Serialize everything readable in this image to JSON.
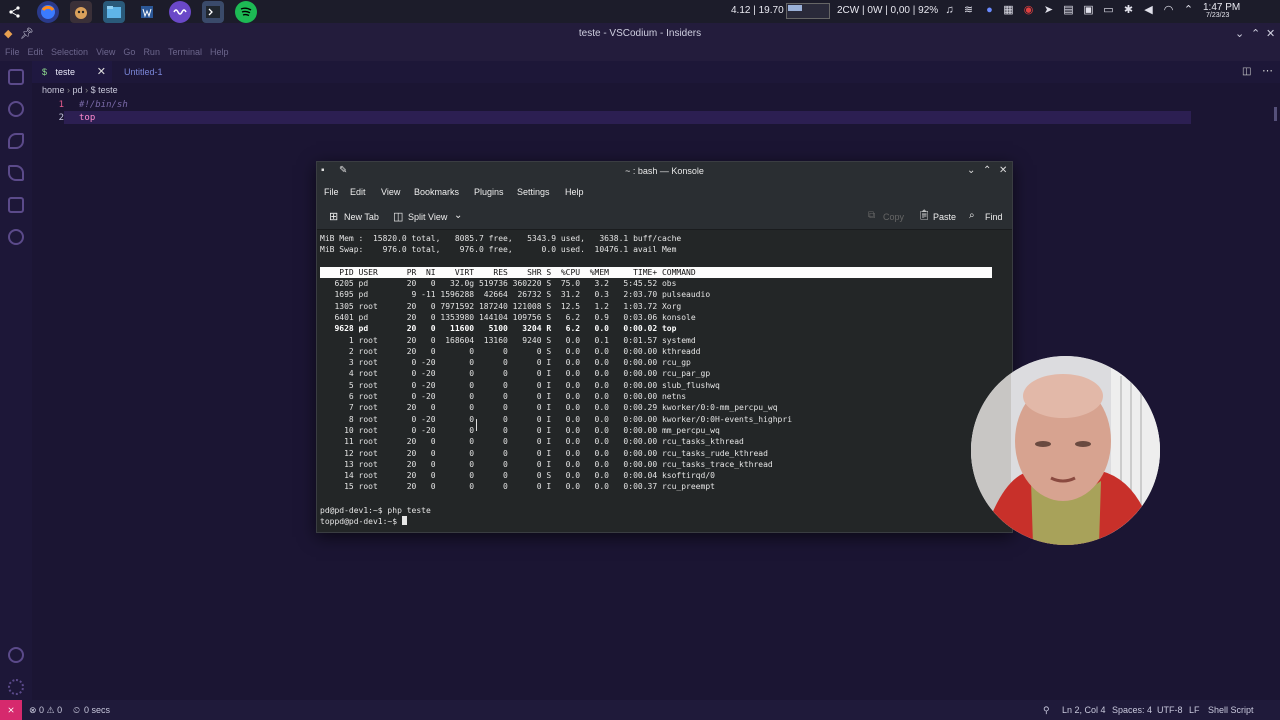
{
  "panel": {
    "tray": {
      "load": "4.12 | 19.70",
      "net": "2CW | 0W | 0,00 | 92%",
      "time": "1:47 PM",
      "date": "7/23/23"
    }
  },
  "vscodium": {
    "title": "teste - VSCodium - Insiders",
    "menu": [
      "File",
      "Edit",
      "Selection",
      "View",
      "Go",
      "Run",
      "Terminal",
      "Help"
    ],
    "tabs": [
      {
        "label": "teste",
        "icon": "$"
      },
      {
        "label": "Untitled-1"
      }
    ],
    "breadcrumb": [
      "home",
      "pd",
      "$ teste"
    ],
    "code": [
      {
        "num": "1",
        "text": "#!/bin/sh"
      },
      {
        "num": "2",
        "text": "top"
      }
    ],
    "status": {
      "problems": "⊗ 0 ⚠ 0",
      "timer": "0 secs",
      "position": "Ln 2, Col 4",
      "spaces": "Spaces: 4",
      "encoding": "UTF-8",
      "eol": "LF",
      "language": "Shell Script"
    },
    "accent": "#d6296d"
  },
  "konsole": {
    "title": "~ : bash — Konsole",
    "menu": [
      "File",
      "Edit",
      "View",
      "Bookmarks",
      "Plugins",
      "Settings",
      "Help"
    ],
    "toolbar": {
      "new_tab": "New Tab",
      "split_view": "Split View",
      "copy": "Copy",
      "paste": "Paste",
      "find": "Find"
    },
    "mem_line": "MiB Mem :  15820.0 total,   8085.7 free,   5343.9 used,   3638.1 buff/cache",
    "swap_line": "MiB Swap:    976.0 total,    976.0 free,      0.0 used.  10476.1 avail Mem",
    "header": "    PID USER      PR  NI    VIRT    RES    SHR S  %CPU  %MEM     TIME+ COMMAND",
    "processes": [
      "   6205 pd        20   0   32.0g 519736 360220 S  75.0   3.2   5:45.52 obs",
      "   1695 pd         9 -11 1596288  42664  26732 S  31.2   0.3   2:03.70 pulseaudio",
      "   1305 root      20   0 7971592 187240 121008 S  12.5   1.2   1:03.72 Xorg",
      "   6401 pd        20   0 1353980 144104 109756 S   6.2   0.9   0:03.06 konsole",
      "   9628 pd        20   0   11600   5100   3204 R   6.2   0.0   0:00.02 top",
      "      1 root      20   0  168604  13160   9240 S   0.0   0.1   0:01.57 systemd",
      "      2 root      20   0       0      0      0 S   0.0   0.0   0:00.00 kthreadd",
      "      3 root       0 -20       0      0      0 I   0.0   0.0   0:00.00 rcu_gp",
      "      4 root       0 -20       0      0      0 I   0.0   0.0   0:00.00 rcu_par_gp",
      "      5 root       0 -20       0      0      0 I   0.0   0.0   0:00.00 slub_flushwq",
      "      6 root       0 -20       0      0      0 I   0.0   0.0   0:00.00 netns",
      "      7 root      20   0       0      0      0 I   0.0   0.0   0:00.29 kworker/0:0-mm_percpu_wq",
      "      8 root       0 -20       0      0      0 I   0.0   0.0   0:00.00 kworker/0:0H-events_highpri",
      "     10 root       0 -20       0      0      0 I   0.0   0.0   0:00.00 mm_percpu_wq",
      "     11 root      20   0       0      0      0 I   0.0   0.0   0:00.00 rcu_tasks_kthread",
      "     12 root      20   0       0      0      0 I   0.0   0.0   0:00.00 rcu_tasks_rude_kthread",
      "     13 root      20   0       0      0      0 I   0.0   0.0   0:00.00 rcu_tasks_trace_kthread",
      "     14 root      20   0       0      0      0 S   0.0   0.0   0:00.04 ksoftirqd/0",
      "     15 root      20   0       0      0      0 I   0.0   0.0   0:00.37 rcu_preempt"
    ],
    "prompt1": "pd@pd-dev1:~$ php teste",
    "prompt2": "toppd@pd-dev1:~$ "
  }
}
